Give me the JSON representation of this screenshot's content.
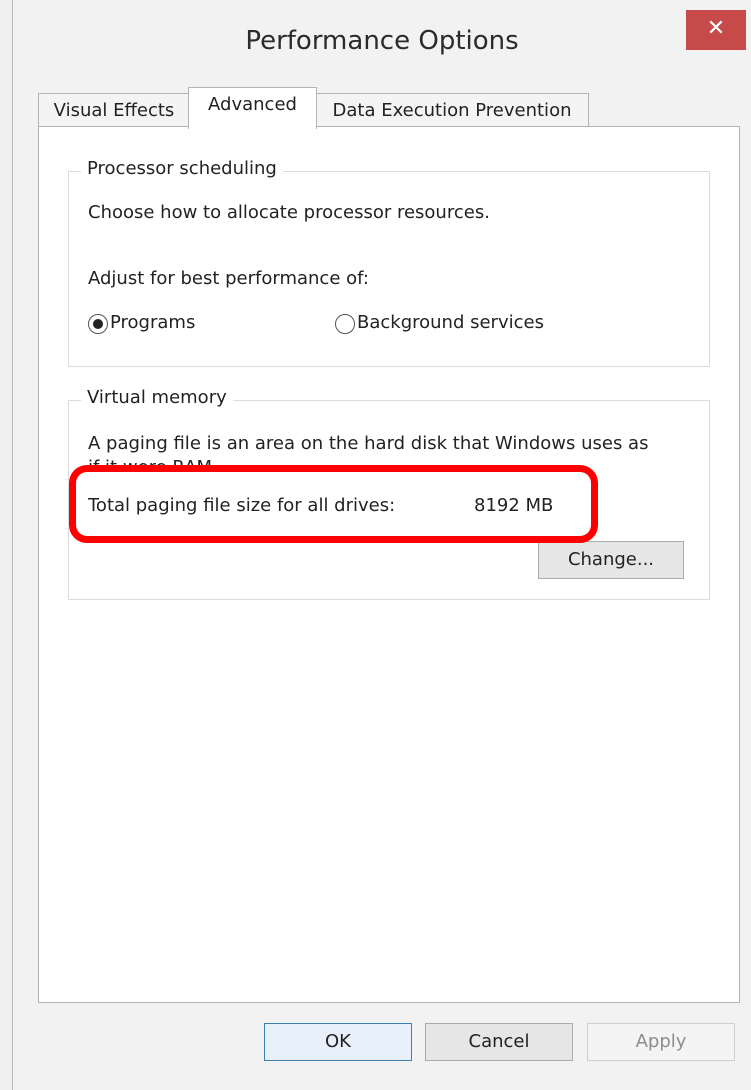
{
  "window": {
    "title": "Performance Options"
  },
  "titlebar": {
    "close_glyph": "✕"
  },
  "tabs": [
    {
      "label": "Visual Effects"
    },
    {
      "label": "Advanced",
      "active": true
    },
    {
      "label": "Data Execution Prevention"
    }
  ],
  "processor": {
    "legend": "Processor scheduling",
    "description": "Choose how to allocate processor resources.",
    "adjust_label": "Adjust for best performance of:",
    "option_programs": "Programs",
    "option_background": "Background services",
    "selected": "Programs"
  },
  "virtual_memory": {
    "legend": "Virtual memory",
    "description": "A paging file is an area on the hard disk that Windows uses as",
    "description_cont": "if it were RAM.",
    "total_label": "Total paging file size for all drives:",
    "total_value": "8192 MB",
    "change_button": "Change..."
  },
  "footer": {
    "ok": "OK",
    "cancel": "Cancel",
    "apply": "Apply"
  },
  "highlight": {
    "color": "#ff0000"
  }
}
